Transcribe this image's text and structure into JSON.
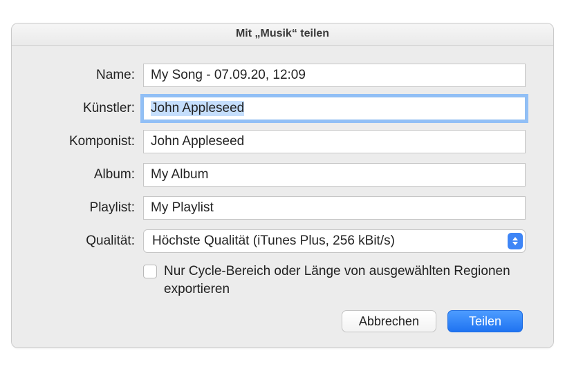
{
  "window": {
    "title": "Mit „Musik“ teilen"
  },
  "form": {
    "name_label": "Name:",
    "name_value": "My Song - 07.09.20, 12:09",
    "artist_label": "Künstler:",
    "artist_value": "John Appleseed",
    "composer_label": "Komponist:",
    "composer_value": "John Appleseed",
    "album_label": "Album:",
    "album_value": "My Album",
    "playlist_label": "Playlist:",
    "playlist_value": "My Playlist",
    "quality_label": "Qualität:",
    "quality_value": "Höchste Qualität (iTunes Plus, 256 kBit/s)",
    "cycle_checkbox_label": "Nur Cycle-Bereich oder Länge von ausgewählten Regionen exportieren",
    "cycle_checkbox_checked": false
  },
  "buttons": {
    "cancel": "Abbrechen",
    "share": "Teilen"
  }
}
